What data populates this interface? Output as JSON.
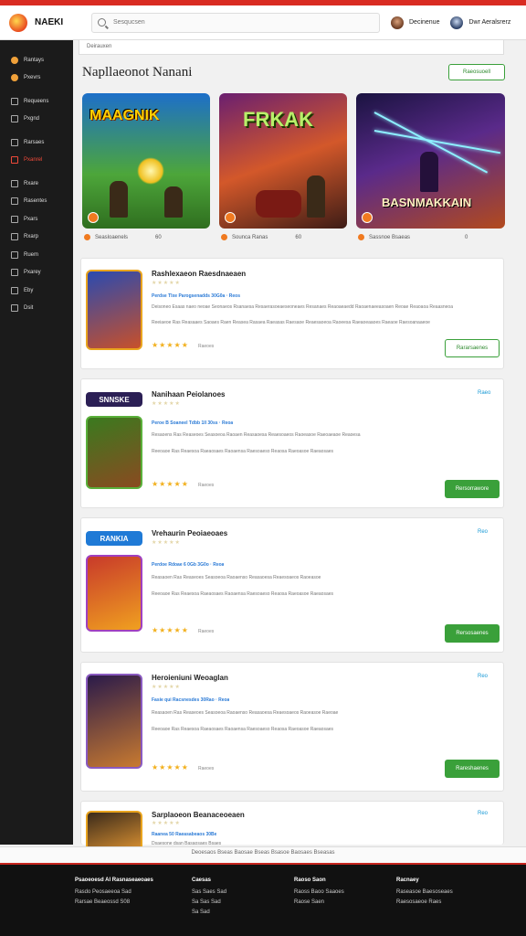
{
  "header": {
    "brand": "NAEKI",
    "search_placeholder": "Sesqucsen",
    "user1": "Decinenue",
    "user2": "Dwr Aeralsrerz"
  },
  "sidebar": {
    "items": [
      {
        "label": "Rantays",
        "icon": "flame-icon"
      },
      {
        "label": "Pxevrs",
        "icon": "flame-icon"
      },
      {
        "label": "Requeens",
        "icon": "grid-icon"
      },
      {
        "label": "Pxgnd",
        "icon": "grid-icon"
      },
      {
        "label": "Rarsaes",
        "icon": "grid-icon"
      },
      {
        "label": "Pxanrel",
        "icon": "flag-icon"
      },
      {
        "label": "Rxare",
        "icon": "gear-icon"
      },
      {
        "label": "Rasentes",
        "icon": "gear-icon"
      },
      {
        "label": "Pxars",
        "icon": "grid-icon"
      },
      {
        "label": "Rxarp",
        "icon": "grid-icon"
      },
      {
        "label": "Ruem",
        "icon": "grid-icon"
      },
      {
        "label": "Pxarey",
        "icon": "grid-icon"
      },
      {
        "label": "Eby",
        "icon": "grid-icon"
      },
      {
        "label": "Dsit",
        "icon": "gear-icon"
      }
    ]
  },
  "main": {
    "breadcrumb": "Deirauxen",
    "title": "Napllaeonot Nanani",
    "title_button": "Raeosuoell",
    "heroes": [
      {
        "title": "MAAGNIK",
        "meta": "Seasloaenels",
        "count": "60"
      },
      {
        "title": "FRKAK",
        "meta": "Sounca Ranas",
        "count": "60"
      },
      {
        "title": "BASNMAKKAIN",
        "meta": "Sassnoe Bsaeas",
        "count": "0"
      }
    ],
    "games": [
      {
        "name": "Rashlexaeon Raesdnaeaen",
        "tag": "",
        "line1": "Perdse Tlxe Parogsenadds 30G0a · Reos",
        "line2": "Deisoneo Esaas naeo neoae Seonaeos Rsanaesa Resaerasoeaeseoneaes Resanaes Reaoaeaedd Raoaenaeeasoaen Reoae Reaoaoa Reaasneoa",
        "line3": "Reeiaeoe Ras Reasaaes Saoaes Raen Reasea Rasaea Raeasas Raesaoe Reaesaoeoa Raoeesa Raeaoeaaoes Raeaoe Raesoanaaeoe",
        "rating_label": "Raeoes",
        "button": "Rararsaenes",
        "logo": ""
      },
      {
        "name": "Nanihaan Peiolanoes",
        "tag": "Raeo",
        "line1": "Peroe B Soaneel Tdbb 1ll 30ss · Reoa",
        "line2": "Resaoens Ras Reaseoes Seasoeoa Raoaen Reasaoesa Reaesoaeos Raoeasoe Raeoaeaoe Reaoesa",
        "line3": "Reeoaoe Ras Reaesoa Raeaosaes Raoaensa Raesoaeso Reaosa Raeoasoe Raeaosaes",
        "rating_label": "Raeoes",
        "button": "Rersorrawore",
        "logo": "SNNSKE"
      },
      {
        "name": "Vrehaurin Peoiaeoaes",
        "tag": "Reo",
        "line1": "Perdoe Rdoae 6 0Gb 3G0o · Reoa",
        "line2": "Reasaoen Ras Reaseoes Seasoeoa Raoaenso Reasaoesa Reaesoaeos Raoeasoe",
        "line3": "Reeoaoe Ras Reaesoa Raeaosaes Raoaensa Raesoaeso Reaosa Raeoasoe Raeaosaes",
        "rating_label": "Raeoes",
        "button": "Rersosaenes",
        "logo": "RANKIA"
      },
      {
        "name": "Heroieniuni Weoaglan",
        "tag": "Reo",
        "line1": "Fasie qui Racsnesdes 30Rao · Reoa",
        "line2": "Reasaoen Ras Reaseoes Seasoeoa Raoaenso Reasaoesa Reaesoaeos Raoeasoe Raeoae",
        "line3": "Reeoaoe Ras Reaesoa Raeaosaes Raoaensa Raesoaeso Reaosa Raeoasoe Raeaosaes",
        "rating_label": "Raeoes",
        "button": "Rareshaenes",
        "logo": ""
      },
      {
        "name": "Sarplaoeon Beanaceoeaen",
        "tag": "Reo",
        "line1": "Raanea 50 Raeasabeaos 30Be",
        "line2": "Dsaesone dsan Basaosaes Bsaes",
        "line3": "",
        "rating_label": "",
        "button": "",
        "logo": ""
      }
    ]
  },
  "bottom_bar": "Deoesaos Bseas Baosae Bseas Bsasoe Baosaes Bseasas",
  "footer": {
    "col1": {
      "heading": "Psaoeoesd Al Rasnaseaeoaes",
      "items": [
        "Rasdo Peosaeeoa Sad",
        "Rarsae Beaeossd S08"
      ]
    },
    "col2": {
      "heading": "Caesas",
      "items": [
        "Sas Saes Sad",
        "Sa Sas Sad",
        "Sa Sad"
      ]
    },
    "col3": {
      "heading": "Raoso Saon",
      "items": [
        "Raoss Baoo Saaoes",
        "Raose Saen"
      ]
    },
    "col4": {
      "heading": "Racnaey",
      "items": [
        "Raseasoe Baesoseaes",
        "Raesosaeoe Raes"
      ]
    }
  },
  "colors": {
    "accent_red": "#d92b22",
    "cta_green": "#3aa03a",
    "star": "#f2b01e",
    "link_blue": "#1a9ad6"
  }
}
